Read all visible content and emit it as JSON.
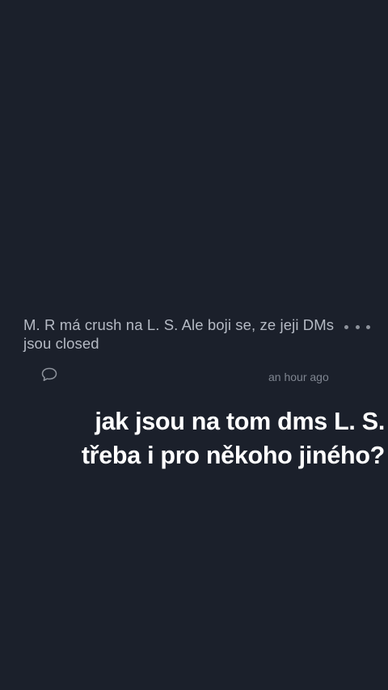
{
  "post": {
    "text": "M. R má crush na L. S. Ale boji se, ze jeji DMs jsou closed",
    "timestamp": "an hour ago",
    "more_icon": "more-horizontal-icon",
    "comment_icon": "speech-bubble-icon"
  },
  "overlay": {
    "line1": "jak jsou na tom dms L. S.",
    "line2": "třeba i pro někoho jiného?"
  },
  "colors": {
    "background": "#1b202b",
    "post_text": "#b5bac4",
    "muted_text": "#7f8590",
    "overlay_text": "#ffffff"
  }
}
